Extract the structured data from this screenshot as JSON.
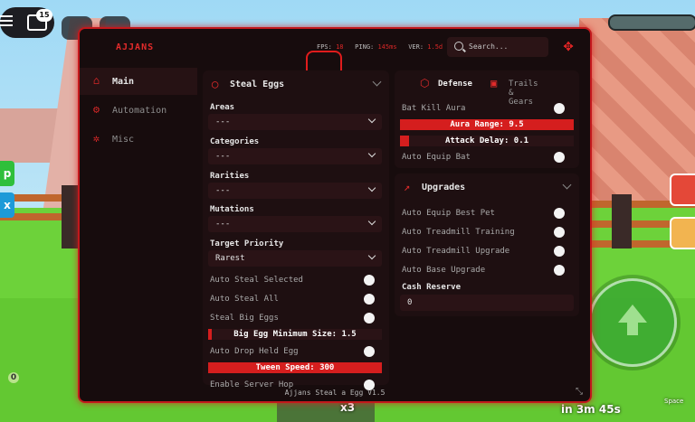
{
  "hud": {
    "chat_badge": "15",
    "side_left_1": "p",
    "side_left_2": "x",
    "multiplier": "x3",
    "timer": "in 3m 45s",
    "space_key": "Space",
    "coin_marker": "0"
  },
  "header": {
    "brand": "AJJANS",
    "fps_label": "FPS:",
    "fps_value": "18",
    "ping_label": "PING:",
    "ping_value": "145ms",
    "ver_label": "VER:",
    "ver_value": "1.5d",
    "search_placeholder": "Search..."
  },
  "sidebar": {
    "items": [
      {
        "label": "Main",
        "icon": "home-icon",
        "active": true
      },
      {
        "label": "Automation",
        "icon": "gear-icon",
        "active": false
      },
      {
        "label": "Misc",
        "icon": "cog-icon",
        "active": false
      }
    ]
  },
  "steal_eggs": {
    "title": "Steal Eggs",
    "areas_label": "Areas",
    "areas_value": "---",
    "categories_label": "Categories",
    "categories_value": "---",
    "rarities_label": "Rarities",
    "rarities_value": "---",
    "mutations_label": "Mutations",
    "mutations_value": "---",
    "priority_label": "Target Priority",
    "priority_value": "Rarest",
    "auto_steal_selected": "Auto Steal Selected",
    "auto_steal_all": "Auto Steal All",
    "steal_big_eggs": "Steal Big Eggs",
    "big_egg_slider": "Big Egg Minimum Size: 1.5",
    "big_egg_fill": 0.02,
    "auto_drop": "Auto Drop Held Egg",
    "tween_slider": "Tween Speed: 300",
    "tween_fill": 1.0,
    "enable_server_hop": "Enable Server Hop"
  },
  "defense": {
    "tab_defense": "Defense",
    "tab_trails": "Trails & Gears",
    "bat_kill_aura": "Bat Kill Aura",
    "aura_range_slider": "Aura Range: 9.5",
    "aura_fill": 1.0,
    "attack_delay_slider": "Attack Delay: 0.1",
    "attack_fill": 0.05,
    "auto_equip_bat": "Auto Equip Bat"
  },
  "upgrades": {
    "title": "Upgrades",
    "auto_equip_best_pet": "Auto Equip Best Pet",
    "auto_treadmill_training": "Auto Treadmill Training",
    "auto_treadmill_upgrade": "Auto Treadmill Upgrade",
    "auto_base_upgrade": "Auto Base Upgrade",
    "cash_reserve_label": "Cash Reserve",
    "cash_reserve_value": "0"
  },
  "footer": {
    "text": "Ajjans Steal a Egg V1.5"
  },
  "colors": {
    "accent": "#e42b2b",
    "panel_bg": "#170c0d",
    "section_bg": "#1e0f11"
  }
}
